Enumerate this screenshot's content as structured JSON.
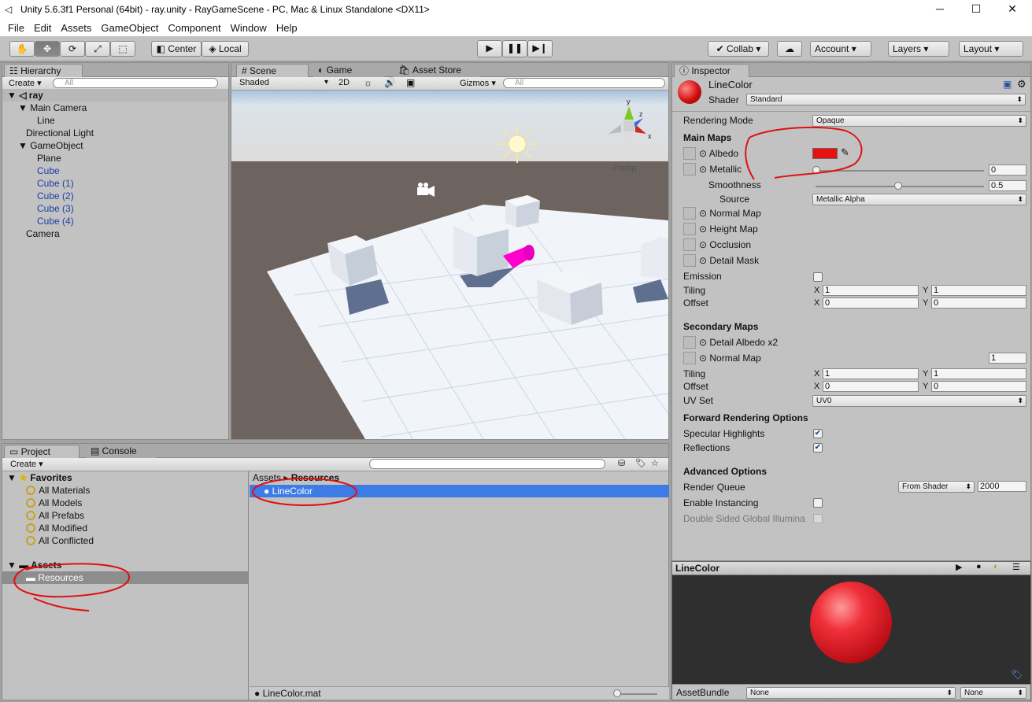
{
  "window": {
    "title": "Unity 5.6.3f1 Personal (64bit) - ray.unity - RayGameScene - PC, Mac & Linux Standalone <DX11>",
    "min": "─",
    "max": "☐",
    "close": "✕"
  },
  "menu": [
    "File",
    "Edit",
    "Assets",
    "GameObject",
    "Component",
    "Window",
    "Help"
  ],
  "toolbar": {
    "pivot": "Center",
    "space": "Local",
    "collab": "Collab",
    "account": "Account",
    "layers": "Layers",
    "layout": "Layout"
  },
  "hierarchy": {
    "tab": "Hierarchy",
    "create": "Create",
    "search": "All",
    "scene": "ray",
    "items": [
      "Main Camera",
      "Line",
      "Directional Light",
      "GameObject",
      "Plane",
      "Cube",
      "Cube (1)",
      "Cube (2)",
      "Cube (3)",
      "Cube (4)",
      "Camera"
    ]
  },
  "scene": {
    "tabs": [
      "Scene",
      "Game",
      "Asset Store"
    ],
    "shading": "Shaded",
    "mode2d": "2D",
    "gizmos": "Gizmos",
    "search": "All",
    "persp": "Persp",
    "axes": {
      "y": "y",
      "z": "z",
      "x": "x"
    }
  },
  "project": {
    "tabs": [
      "Project",
      "Console"
    ],
    "create": "Create",
    "favorites_label": "Favorites",
    "favorites": [
      "All Materials",
      "All Models",
      "All Prefabs",
      "All Modified",
      "All Conflicted"
    ],
    "assets_label": "Assets",
    "resources": "Resources",
    "breadcrumb": [
      "Assets",
      "Resources"
    ],
    "selected_asset": "LineColor",
    "footer": "LineColor.mat"
  },
  "inspector": {
    "tab": "Inspector",
    "material": "LineColor",
    "shader_label": "Shader",
    "shader": "Standard",
    "rendering_mode_label": "Rendering Mode",
    "rendering_mode": "Opaque",
    "main_maps": "Main Maps",
    "albedo": "Albedo",
    "metallic": "Metallic",
    "metallic_val": "0",
    "smoothness": "Smoothness",
    "smoothness_val": "0.5",
    "source": "Source",
    "source_val": "Metallic Alpha",
    "normal_map": "Normal Map",
    "height_map": "Height Map",
    "occlusion": "Occlusion",
    "detail_mask": "Detail Mask",
    "emission": "Emission",
    "tiling": "Tiling",
    "offset": "Offset",
    "x": "X",
    "y": "Y",
    "one": "1",
    "zero": "0",
    "secondary_maps": "Secondary Maps",
    "detail_albedo": "Detail Albedo x2",
    "normal_map2": "Normal Map",
    "normal_val": "1",
    "uv_set": "UV Set",
    "uv_val": "UV0",
    "forward": "Forward Rendering Options",
    "specular": "Specular Highlights",
    "reflections": "Reflections",
    "advanced": "Advanced Options",
    "render_queue": "Render Queue",
    "render_queue_mode": "From Shader",
    "render_queue_val": "2000",
    "instancing": "Enable Instancing",
    "double_sided": "Double Sided Global Illumina",
    "preview_title": "LineColor",
    "assetbundle": "AssetBundle",
    "ab_none": "None",
    "ab_none2": "None"
  },
  "colors": {
    "albedo": "#e81010",
    "selection": "#3d7be6",
    "highlight_ring": "#e01010"
  }
}
